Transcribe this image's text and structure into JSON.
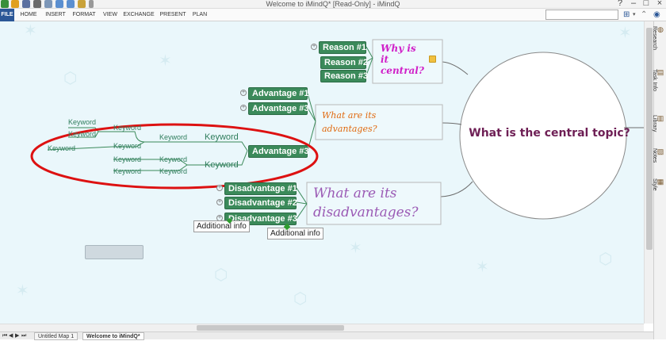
{
  "window": {
    "title": "Welcome to iMindQ* [Read-Only] - iMindQ"
  },
  "ribbon": {
    "tabs": [
      "FILE",
      "HOME",
      "INSERT",
      "FORMAT",
      "VIEW",
      "EXCHANGE",
      "PRESENT",
      "PLAN"
    ],
    "search_placeholder": ""
  },
  "side_panel": {
    "tabs": [
      "Research",
      "Task Info",
      "Library",
      "Notes",
      "Style"
    ]
  },
  "map": {
    "central_topic": "What is the central topic?",
    "why_central": "Why is\nit\ncentral?",
    "advantages_prompt": "What are its\nadvantages?",
    "disadvantages_prompt": "What are its\ndisadvantages?",
    "reasons": [
      "Reason #1",
      "Reason #2",
      "Reason #3"
    ],
    "advantages": [
      "Advantage #1",
      "Advantage #3",
      "Advantage #3"
    ],
    "disadvantages": [
      "Disadvantage #1",
      "Disadvantage #2",
      "Disadvantage #3"
    ],
    "keywords": {
      "k1": "Keyword",
      "k2": "Keyword",
      "k3": "Keyword",
      "k4": "Keyword",
      "k5": "Keyword",
      "k6": "Keyword",
      "k7": "Keyword",
      "k8": "Keyword",
      "k9": "Keyword",
      "k10": "Keyword",
      "k11": "Keyword"
    },
    "callouts": {
      "c1": "Additional info",
      "c2": "Additional info"
    },
    "colors": {
      "node": "#3b8a5a",
      "keyword": "#2f7d5c",
      "why": "#d020c8",
      "advantages": "#e06a10",
      "disadvantages": "#9b5bb5",
      "central": "#6e1f55",
      "annotation": "#dd1111"
    }
  },
  "document_tabs": [
    "Untitled Map 1",
    "Welcome to iMindQ*"
  ]
}
